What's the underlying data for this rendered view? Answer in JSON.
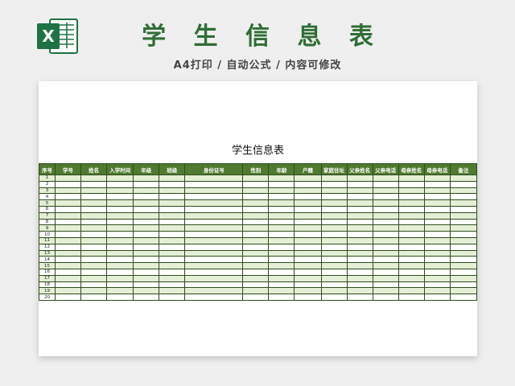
{
  "header": {
    "title": "学 生 信 息 表",
    "subtitle": "A4打印 / 自动公式 / 内容可修改",
    "logo_icon": "excel-logo-icon",
    "logo_letter": "X"
  },
  "sheet": {
    "title": "学生信息表",
    "columns": [
      "序号",
      "学号",
      "姓名",
      "入学时间",
      "年级",
      "班级",
      "身份证号",
      "性别",
      "年龄",
      "户籍",
      "家庭住址",
      "父亲姓名",
      "父亲电话",
      "母亲姓名",
      "母亲电话",
      "备注"
    ],
    "row_numbers": [
      "1",
      "2",
      "3",
      "4",
      "5",
      "6",
      "7",
      "8",
      "9",
      "10",
      "11",
      "12",
      "13",
      "14",
      "15",
      "16",
      "17",
      "18",
      "19",
      "20"
    ]
  },
  "colors": {
    "brand_green": "#2f6e35",
    "header_green": "#4f7a30",
    "band_green": "#e4efd6"
  }
}
